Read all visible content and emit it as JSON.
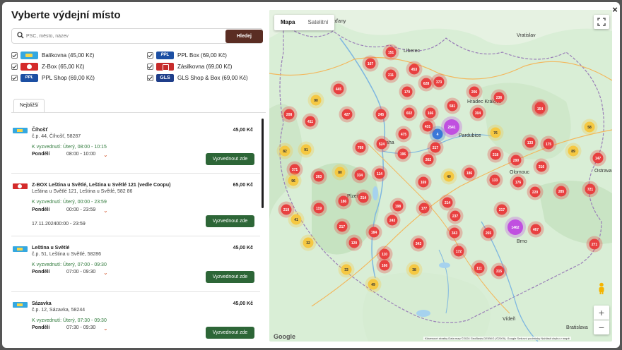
{
  "dialog": {
    "title": "Vyberte výdejní místo",
    "close_label": "×"
  },
  "search": {
    "placeholder": "PSČ, město, název",
    "button": "Hledej"
  },
  "filters": [
    {
      "label": "Balíkovna (45,00 Kč)",
      "checked": true,
      "logo": "balikovna"
    },
    {
      "label": "PPL Box (69,00 Kč)",
      "checked": true,
      "logo": "ppl"
    },
    {
      "label": "Z-Box (65,00 Kč)",
      "checked": true,
      "logo": "zbox"
    },
    {
      "label": "Zásilkovna (69,00 Kč)",
      "checked": true,
      "logo": "zasilkovna"
    },
    {
      "label": "PPL Shop (69,00 Kč)",
      "checked": true,
      "logo": "ppl"
    },
    {
      "label": "GLS Shop & Box (69,00 Kč)",
      "checked": true,
      "logo": "gls"
    }
  ],
  "logo_text": {
    "ppl": "PPL",
    "gls": "GLS"
  },
  "tab": "Nejbližší",
  "places": [
    {
      "name": "Číhošť",
      "address": "č.p. 44, Číhošť, 58287",
      "price": "45,00 Kč",
      "pickup": "K vyzvednutí: Úterý, 08:00 - 10:15",
      "day": "Pondělí",
      "hours": "08:00 - 10:00",
      "button": "Vyzvednout zde",
      "logo": "balikovna"
    },
    {
      "name": "Z-BOX Leština u Světlé, Leština u Světlé 121 (vedle Coopu)",
      "address": "Leština u Světlé 121, Leština u Světlé, 582 86",
      "price": "65,00 Kč",
      "pickup": "K vyzvednutí: Úterý, 00:00 - 23:59",
      "day": "Pondělí",
      "hours": "00:00 - 23:59",
      "extra": "17.11.202400:00 - 23:59",
      "button": "Vyzvednout zde",
      "logo": "zbox"
    },
    {
      "name": "Leština u Světlé",
      "address": "č.p. 51, Leština u Světlé, 58286",
      "price": "45,00 Kč",
      "pickup": "K vyzvednutí: Úterý, 07:00 - 09:30",
      "day": "Pondělí",
      "hours": "07:00 - 09:30",
      "button": "Vyzvednout zde",
      "logo": "balikovna"
    },
    {
      "name": "Sázavka",
      "address": "č.p. 12, Sázavka, 58244",
      "price": "45,00 Kč",
      "pickup": "K vyzvednutí: Úterý, 07:30 - 09:30",
      "day": "Pondělí",
      "hours": "07:30 - 09:30",
      "button": "Vyzvednout zde",
      "logo": "balikovna"
    }
  ],
  "map": {
    "tabs": [
      "Mapa",
      "Satelitní"
    ],
    "active_tab": "Mapa",
    "zoom_in": "+",
    "zoom_out": "−",
    "fullscreen_icon": "fullscreen-icon",
    "pegman_icon": "pegman-icon",
    "attribution": "Klávesové zkratky    Data map ©2024 GeoBasis-DE/BKG (©2009), Google    Smluvní podmínky    Nahlásit chybu v mapě",
    "google_logo": "Google",
    "cities": [
      "Drážďany",
      "Vratislav",
      "Vídeň",
      "Bratislava",
      "Brno",
      "Praha",
      "Pardubice",
      "Liberec",
      "Olomouc",
      "Plzeň",
      "Ostrava",
      "Hradec Králové"
    ],
    "clusters": [
      "151",
      "167",
      "211",
      "453",
      "628",
      "445",
      "170",
      "373",
      "208",
      "206",
      "236",
      "90",
      "427",
      "411",
      "245",
      "602",
      "581",
      "166",
      "212",
      "4",
      "304",
      "154",
      "431",
      "2541",
      "524",
      "475",
      "217",
      "76",
      "58",
      "133",
      "175",
      "89",
      "82",
      "91",
      "769",
      "371",
      "196",
      "262",
      "218",
      "290",
      "316",
      "147",
      "80",
      "96",
      "263",
      "334",
      "114",
      "169",
      "40",
      "186",
      "133",
      "176",
      "721",
      "219",
      "186",
      "119",
      "214",
      "198",
      "177",
      "220",
      "285",
      "217",
      "41",
      "217",
      "243",
      "214",
      "237",
      "343",
      "265",
      "1462",
      "467",
      "32",
      "184",
      "343",
      "120",
      "110",
      "172",
      "111",
      "315",
      "33",
      "166",
      "38",
      "49",
      "271"
    ],
    "colors": {
      "water": "#a6d2ee",
      "land": "#d4ecd1",
      "red_cluster": "#e84040",
      "yellow_cluster": "#f5c842",
      "purple_cluster": "#c050e0",
      "blue_cluster": "#3a78d8"
    }
  },
  "colors": {
    "search_button": "#5a2d23",
    "pick_button": "#2d6637",
    "pickup_text": "#2f7a3b"
  }
}
